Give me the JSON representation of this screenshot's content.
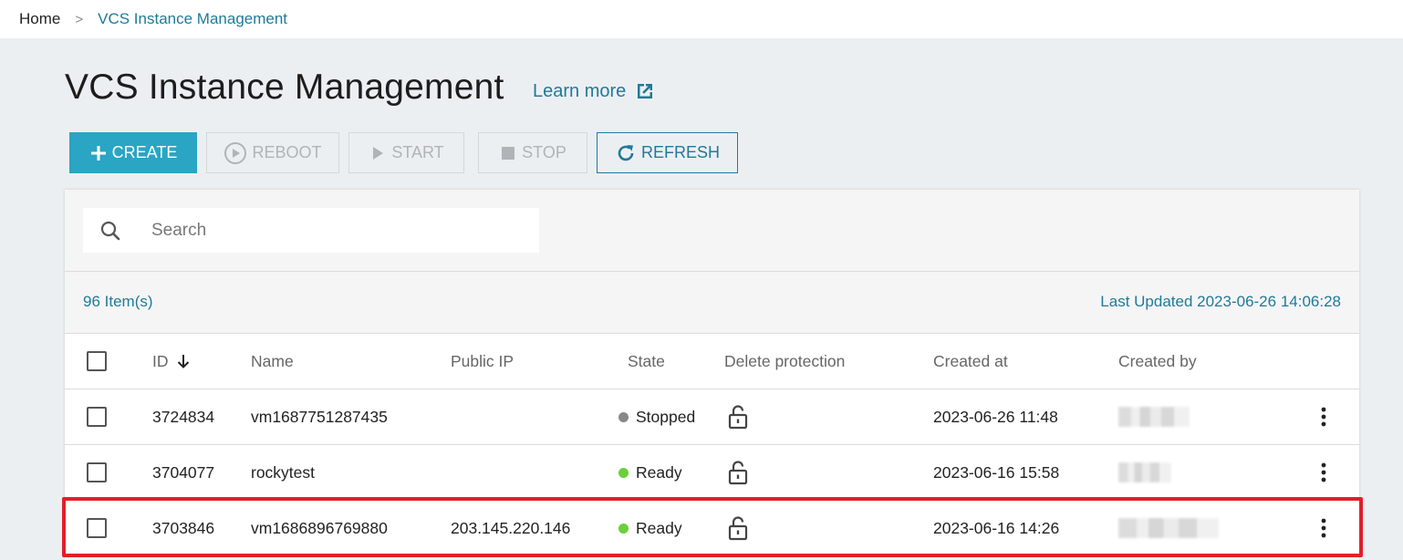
{
  "breadcrumb": {
    "home": "Home",
    "separator": ">",
    "current": "VCS Instance Management"
  },
  "page": {
    "title": "VCS Instance Management",
    "learn_more": "Learn more"
  },
  "toolbar": {
    "create": "CREATE",
    "reboot": "REBOOT",
    "start": "START",
    "stop": "STOP",
    "refresh": "REFRESH"
  },
  "search": {
    "placeholder": "Search"
  },
  "summary": {
    "count": "96 Item(s)",
    "last_updated": "Last Updated 2023-06-26 14:06:28"
  },
  "table": {
    "columns": {
      "id": "ID",
      "name": "Name",
      "public_ip": "Public IP",
      "state": "State",
      "delete_protection": "Delete protection",
      "created_at": "Created at",
      "created_by": "Created by"
    },
    "rows": [
      {
        "id": "3724834",
        "name": "vm1687751287435",
        "public_ip": "",
        "state": "Stopped",
        "created_at": "2023-06-26 11:48"
      },
      {
        "id": "3704077",
        "name": "rockytest",
        "public_ip": "",
        "state": "Ready",
        "created_at": "2023-06-16 15:58"
      },
      {
        "id": "3703846",
        "name": "vm1686896769880",
        "public_ip": "203.145.220.146",
        "state": "Ready",
        "created_at": "2023-06-16 14:26"
      }
    ]
  },
  "colors": {
    "accent": "#2aa5c4",
    "link": "#1f7a99",
    "ready": "#6bcf3a",
    "stopped": "#888888",
    "highlight": "#e0202a"
  }
}
